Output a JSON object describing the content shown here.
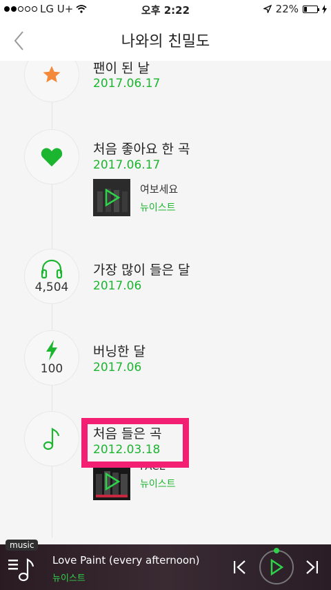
{
  "status_bar": {
    "carrier": "LG U+",
    "time": "오후 2:22",
    "battery": "22%"
  },
  "header": {
    "title": "나와의 친밀도"
  },
  "timeline": [
    {
      "icon": "star-icon",
      "title": "팬이 된 날",
      "date": "2017.06.17"
    },
    {
      "icon": "heart-icon",
      "title": "처음 좋아요 한 곡",
      "date": "2017.06.17",
      "song": {
        "name": "여보세요",
        "artist": "뉴이스트"
      }
    },
    {
      "icon": "headphones-icon",
      "count": "4,504",
      "title": "가장 많이 들은 달",
      "date": "2017.06"
    },
    {
      "icon": "lightning-icon",
      "count": "100",
      "title": "버닝한 달",
      "date": "2017.06"
    },
    {
      "icon": "music-note-icon",
      "title": "처음 들은 곡",
      "date": "2012.03.18",
      "song": {
        "name": "FACE",
        "artist": "뉴이스트"
      }
    }
  ],
  "player": {
    "tag": "music",
    "song_title": "Love Paint (every afternoon)",
    "artist": "뉴이스트"
  },
  "colors": {
    "accent_green": "#1bb530",
    "highlight": "#f21f72",
    "star": "#f5893a"
  }
}
